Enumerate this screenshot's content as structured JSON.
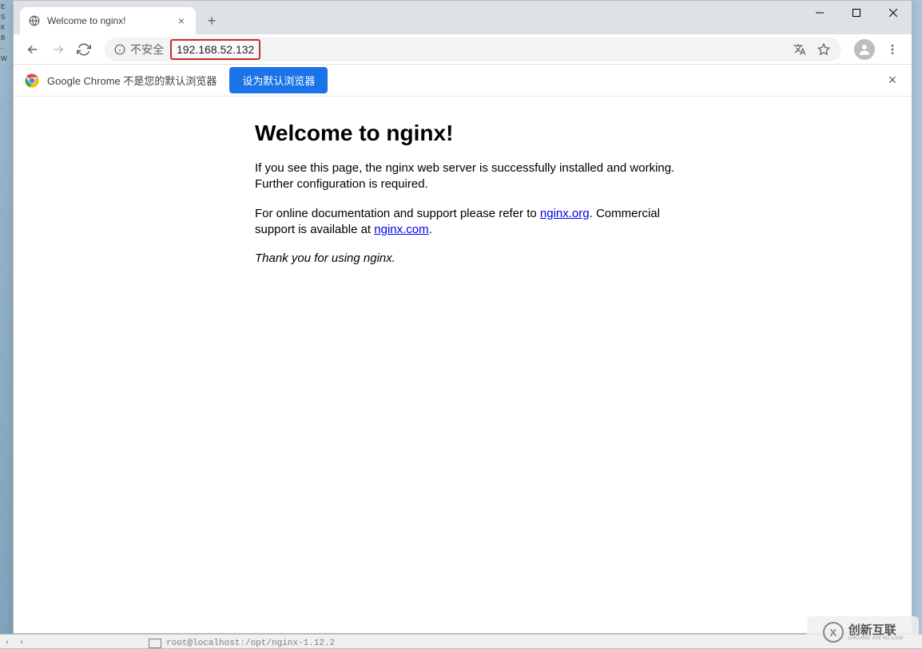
{
  "tab": {
    "title": "Welcome to nginx!"
  },
  "address": {
    "not_secure_label": "不安全",
    "url": "192.168.52.132"
  },
  "infobar": {
    "message": "Google Chrome 不是您的默认浏览器",
    "button_label": "设为默认浏览器"
  },
  "page": {
    "heading": "Welcome to nginx!",
    "p1": "If you see this page, the nginx web server is successfully installed and working. Further configuration is required.",
    "p2_a": "For online documentation and support please refer to ",
    "p2_link1": "nginx.org",
    "p2_b": ". Commercial support is available at ",
    "p2_link2": "nginx.com",
    "p2_c": ".",
    "thanks": "Thank you for using nginx."
  },
  "watermark": {
    "main": "创新互联",
    "sub": "CHUANG XIN HU LIAN"
  },
  "taskbar": {
    "hint": "root@localhost:/opt/nginx-1.12.2"
  }
}
